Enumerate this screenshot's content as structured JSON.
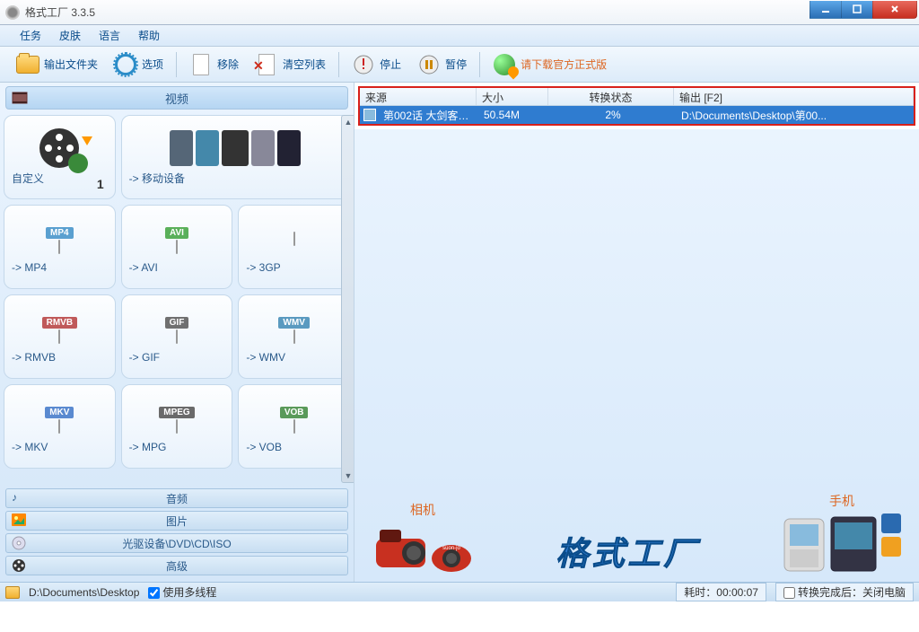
{
  "app": {
    "title": "格式工厂 3.3.5"
  },
  "menu": [
    "任务",
    "皮肤",
    "语言",
    "帮助"
  ],
  "toolbar": {
    "output_folder": "输出文件夹",
    "options": "选项",
    "remove": "移除",
    "clear": "清空列表",
    "stop": "停止",
    "pause": "暂停",
    "download_link": "请下载官方正式版"
  },
  "categories": {
    "video": "视频",
    "audio": "音频",
    "picture": "图片",
    "disc": "光驱设备\\DVD\\CD\\ISO",
    "advanced": "高级",
    "camera": "相机",
    "phone": "手机"
  },
  "formats": [
    {
      "label": "自定义",
      "num": "1",
      "type": "custom"
    },
    {
      "label": "-> 移动设备",
      "type": "mobile",
      "wide": true
    },
    {
      "label": "-> MP4",
      "tag": "MP4",
      "tagcolor": "#5aa0d0"
    },
    {
      "label": "-> AVI",
      "tag": "AVI",
      "tagcolor": "#5ab05a"
    },
    {
      "label": "-> 3GP",
      "tag": "",
      "tagcolor": "#5a8a5a"
    },
    {
      "label": "-> RMVB",
      "tag": "RMVB",
      "tagcolor": "#c05a5a"
    },
    {
      "label": "-> GIF",
      "tag": "GIF",
      "tagcolor": "#707070"
    },
    {
      "label": "-> WMV",
      "tag": "WMV",
      "tagcolor": "#5a9ac0"
    },
    {
      "label": "-> MKV",
      "tag": "MKV",
      "tagcolor": "#5a8ad0"
    },
    {
      "label": "-> MPG",
      "tag": "MPEG",
      "tagcolor": "#6a6a6a"
    },
    {
      "label": "-> VOB",
      "tag": "VOB",
      "tagcolor": "#5a9a5a"
    }
  ],
  "list": {
    "headers": {
      "source": "来源",
      "size": "大小",
      "status": "转换状态",
      "output": "输出 [F2]"
    },
    "row": {
      "source": "第002话 大剑客现...",
      "size": "50.54M",
      "status": "2%",
      "output": "D:\\Documents\\Desktop\\第00..."
    }
  },
  "brand": "格式工厂",
  "status": {
    "path": "D:\\Documents\\Desktop",
    "multithread": "使用多线程",
    "elapsed_label": "耗时：",
    "elapsed": "00:00:07",
    "shutdown": "转换完成后：关闭电脑"
  }
}
